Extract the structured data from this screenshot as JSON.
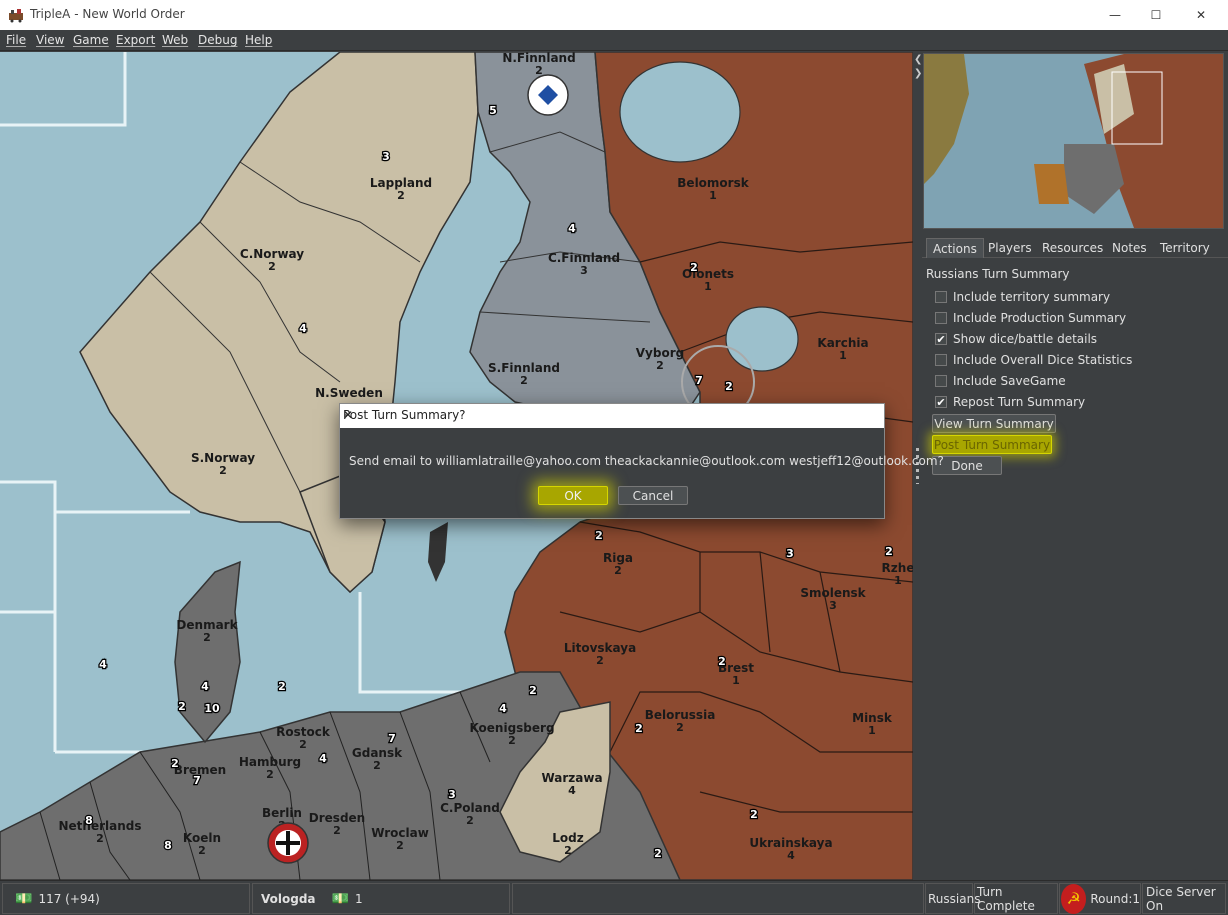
{
  "window": {
    "title": "TripleA - New World Order",
    "minimize_glyph": "—",
    "maximize_glyph": "☐",
    "close_glyph": "✕"
  },
  "menu": {
    "items": [
      "File",
      "View",
      "Game",
      "Export",
      "Web",
      "Debug",
      "Help"
    ]
  },
  "map": {
    "territories": [
      {
        "name": "N.Finnland",
        "units": "2"
      },
      {
        "name": "Lappland",
        "value": "2"
      },
      {
        "name": "Belomorsk",
        "value": "1"
      },
      {
        "name": "C.Norway",
        "value": "2"
      },
      {
        "name": "C.Finnland",
        "value": "3"
      },
      {
        "name": "Olonets",
        "value": "1"
      },
      {
        "name": "Karchia",
        "value": "1"
      },
      {
        "name": "S.Finnland",
        "value": "2"
      },
      {
        "name": "Vyborg",
        "value": "2"
      },
      {
        "name": "N.Sweden",
        "value": ""
      },
      {
        "name": "S.Norway",
        "value": "2"
      },
      {
        "name": "Riga",
        "value": "2"
      },
      {
        "name": "Smolensk",
        "value": "3"
      },
      {
        "name": "Rzhe",
        "value": "1"
      },
      {
        "name": "Denmark",
        "value": "2"
      },
      {
        "name": "Litovskaya",
        "value": "2"
      },
      {
        "name": "Brest",
        "value": "1"
      },
      {
        "name": "Koenigsberg",
        "value": "2"
      },
      {
        "name": "Belorussia",
        "value": "2"
      },
      {
        "name": "Minsk",
        "value": "1"
      },
      {
        "name": "Rostock",
        "value": "2"
      },
      {
        "name": "Hamburg",
        "value": "2"
      },
      {
        "name": "Gdansk",
        "value": "2"
      },
      {
        "name": "Bremen",
        "value": ""
      },
      {
        "name": "Warzawa",
        "value": "4"
      },
      {
        "name": "Netherlands",
        "value": "2"
      },
      {
        "name": "Berlin",
        "value": "2"
      },
      {
        "name": "Dresden",
        "value": "2"
      },
      {
        "name": "C.Poland",
        "value": "2"
      },
      {
        "name": "Wroclaw",
        "value": "2"
      },
      {
        "name": "Koeln",
        "value": "2"
      },
      {
        "name": "Lodz",
        "value": "2"
      },
      {
        "name": "Ukrainskaya",
        "value": "4"
      }
    ],
    "unit_counts": [
      "2",
      "5",
      "3",
      "4",
      "4",
      "2",
      "7",
      "2",
      "2",
      "3",
      "2",
      "4",
      "2",
      "2",
      "4",
      "10",
      "2",
      "4",
      "7",
      "2",
      "7",
      "2",
      "2",
      "4",
      "3",
      "8",
      "8",
      "2",
      "2"
    ]
  },
  "right_panel": {
    "tabs": [
      "Actions",
      "Players",
      "Resources",
      "Notes",
      "Territory"
    ],
    "active_tab": "Actions",
    "summary_title": "Russians Turn Summary",
    "options": [
      {
        "label": "Include territory summary",
        "checked": false
      },
      {
        "label": "Include Production Summary",
        "checked": false
      },
      {
        "label": "Show dice/battle details",
        "checked": true
      },
      {
        "label": "Include Overall Dice Statistics",
        "checked": false
      },
      {
        "label": "Include SaveGame",
        "checked": false
      },
      {
        "label": "Repost Turn Summary",
        "checked": true
      }
    ],
    "buttons": {
      "view_summary": "View Turn Summary",
      "post_summary": "Post Turn Summary",
      "done": "Done"
    }
  },
  "dialog": {
    "title": "Post Turn Summary?",
    "close_glyph": "✕",
    "message": "Send email to williamlatraille@yahoo.com theackackannie@outlook.com westjeff12@outlook.com?",
    "ok_label": "OK",
    "cancel_label": "Cancel"
  },
  "status_bar": {
    "pus": "117 (+94)",
    "territory": "Vologda",
    "territory_pus": "1",
    "player": "Russians",
    "step": "Turn Complete",
    "round": "Round:1",
    "dice_server": "Dice Server On"
  },
  "colors": {
    "water": "#9cc0cc",
    "germany": "#6e6e6e",
    "finland": "#8a929a",
    "neutral": "#c9bfa6",
    "russia": "#8c4a30",
    "highlight": "#a8a600"
  }
}
